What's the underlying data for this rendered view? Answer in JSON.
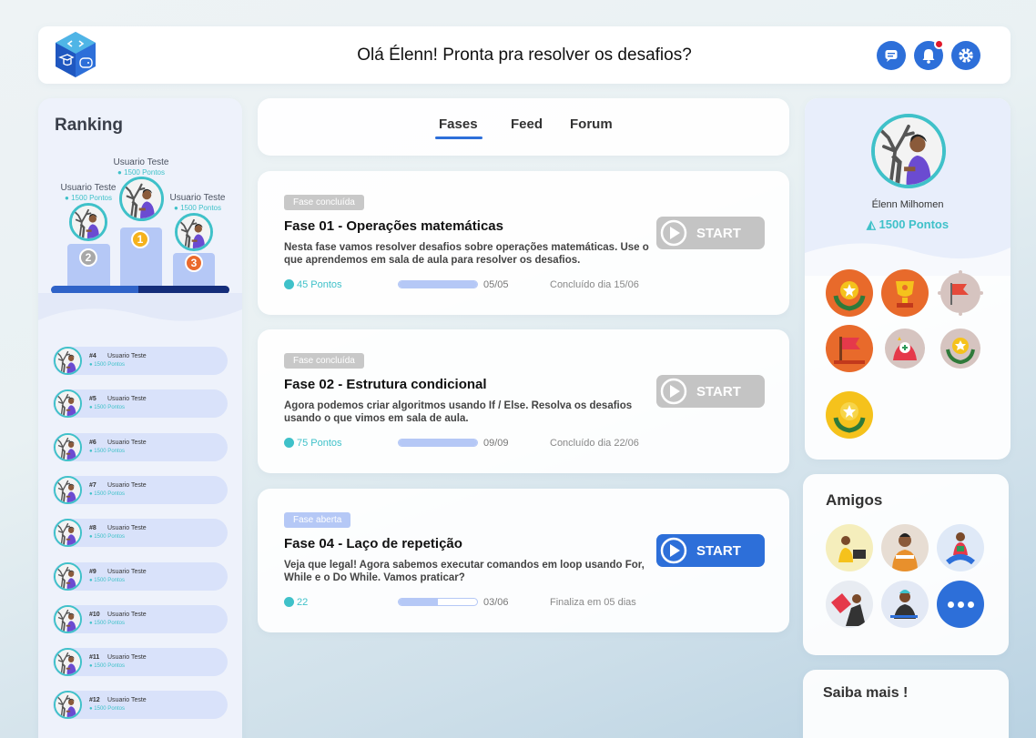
{
  "header": {
    "greeting": "Olá Élenn! Pronta pra resolver os desafios?"
  },
  "ranking": {
    "title": "Ranking",
    "podium": [
      {
        "place": "1",
        "name": "Usuario Teste",
        "points": "1500 Pontos"
      },
      {
        "place": "2",
        "name": "Usuario Teste",
        "points": "1500 Pontos"
      },
      {
        "place": "3",
        "name": "Usuario Teste",
        "points": "1500 Pontos"
      }
    ],
    "list": [
      {
        "pos": "#4",
        "name": "Usuario Teste",
        "points": "1500 Pontos"
      },
      {
        "pos": "#5",
        "name": "Usuario Teste",
        "points": "1500 Pontos"
      },
      {
        "pos": "#6",
        "name": "Usuario Teste",
        "points": "1500 Pontos"
      },
      {
        "pos": "#7",
        "name": "Usuario Teste",
        "points": "1500 Pontos"
      },
      {
        "pos": "#8",
        "name": "Usuario Teste",
        "points": "1500 Pontos"
      },
      {
        "pos": "#9",
        "name": "Usuario Teste",
        "points": "1500 Pontos"
      },
      {
        "pos": "#10",
        "name": "Usuario Teste",
        "points": "1500 Pontos"
      },
      {
        "pos": "#11",
        "name": "Usuario Teste",
        "points": "1500 Pontos"
      },
      {
        "pos": "#12",
        "name": "Usuario Teste",
        "points": "1500 Pontos"
      }
    ]
  },
  "tabs": [
    {
      "label": "Fases",
      "active": true
    },
    {
      "label": "Feed",
      "active": false
    },
    {
      "label": "Forum",
      "active": false
    }
  ],
  "phases": [
    {
      "badge": "Fase concluída",
      "title": "Fase 01 - Operações matemáticas",
      "desc": "Nesta fase vamos resolver desafios sobre operações matemáticas. Use o que aprendemos em sala de aula para resolver os desafios.",
      "points": "45 Pontos",
      "progress": 1.0,
      "count": "05/05",
      "status": "Concluído dia 15/06",
      "start": "START",
      "enabled": false
    },
    {
      "badge": "Fase concluída",
      "title": "Fase 02 - Estrutura condicional",
      "desc": "Agora podemos criar algoritmos usando If / Else. Resolva os desafios usando o que vimos em sala de aula.",
      "points": "75 Pontos",
      "progress": 1.0,
      "count": "09/09",
      "status": "Concluído dia 22/06",
      "start": "START",
      "enabled": false
    },
    {
      "badge": "Fase  aberta",
      "title": "Fase 04 - Laço de repetição",
      "desc": "Veja que legal! Agora sabemos executar comandos em loop usando For, While e o Do While. Vamos praticar?",
      "points": "22",
      "progress": 0.5,
      "count": "03/06",
      "status": "Finaliza em 05 dias",
      "start": "START",
      "enabled": true
    }
  ],
  "profile": {
    "name": "Élenn Milhomen",
    "points": "1500 Pontos"
  },
  "friends": {
    "title": "Amigos"
  },
  "saiba": {
    "title": "Saiba mais !"
  },
  "colors": {
    "accent": "#2d6fd9",
    "teal": "#3fc1c9",
    "disabled": "#c4c4c4",
    "badge_done": "#c8c8c8",
    "badge_open": "#b5c8f6"
  }
}
